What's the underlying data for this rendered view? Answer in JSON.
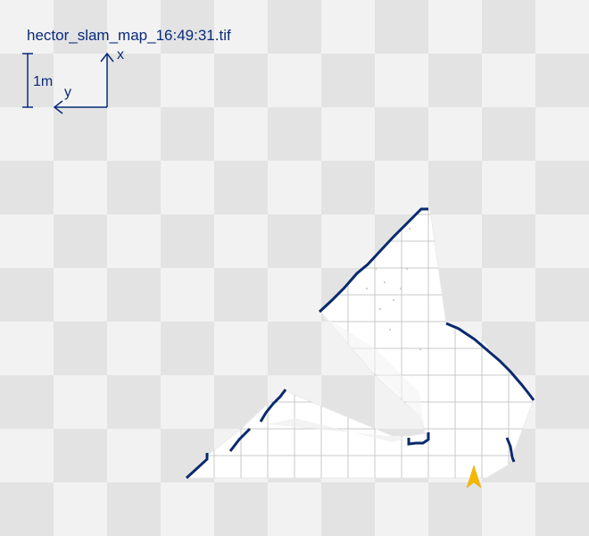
{
  "map": {
    "filename": "hector_slam_map_16:49:31.tif",
    "scale_label": "1m",
    "axis_x_label": "x",
    "axis_y_label": "y"
  },
  "colors": {
    "wall": "#0a2a6e",
    "free_space": "#ffffff",
    "grid": "#c8c8c8",
    "robot_marker": "#f5b800",
    "annotation": "#0a2a7a"
  },
  "icons": {
    "robot": "robot-position-arrow-icon",
    "axes": "coordinate-axes-icon"
  }
}
